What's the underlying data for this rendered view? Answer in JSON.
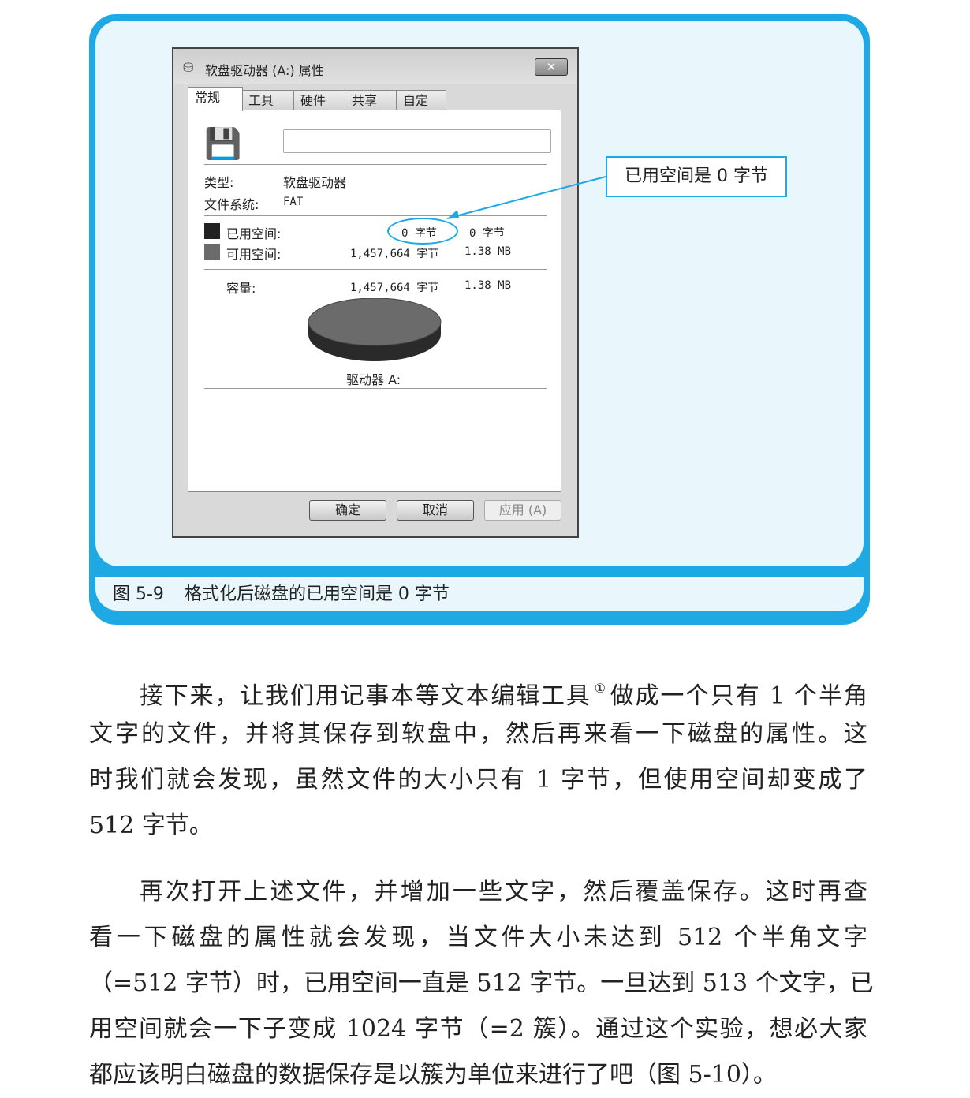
{
  "dialog": {
    "title": "软盘驱动器 (A:) 属性",
    "close": "✕",
    "tabs": [
      "常规",
      "工具",
      "硬件",
      "共享",
      "自定义"
    ],
    "name_value": "",
    "type_label": "类型:",
    "type_value": "软盘驱动器",
    "fs_label": "文件系统:",
    "fs_value": "FAT",
    "used_label": "已用空间:",
    "used_bytes": "0 字节",
    "used_size": "0 字节",
    "free_label": "可用空间:",
    "free_bytes": "1,457,664 字节",
    "free_size": "1.38 MB",
    "cap_label": "容量:",
    "cap_bytes": "1,457,664 字节",
    "cap_size": "1.38 MB",
    "drive_label": "驱动器 A:",
    "ok": "确定",
    "cancel": "取消",
    "apply": "应用 (A)",
    "colors": {
      "used": "#222222",
      "free": "#6b6b6b"
    }
  },
  "callout": "已用空间是 0 字节",
  "caption": {
    "number": "图 5-9",
    "text": "格式化后磁盘的已用空间是 0 字节"
  },
  "body": {
    "p1_line1_a": "接下来，让我们用记事本等文本编辑工具",
    "p1_footnote": "①",
    "p1_line1_b": "做成一个只有 1 个半角",
    "p1_lines": [
      "文字的文件，并将其保存到软盘中，然后再来看一下磁盘的属性。这",
      "时我们就会发现，虽然文件的大小只有 1 字节，但使用空间却变成了",
      "512 字节。"
    ],
    "p2_lines": [
      "再次打开上述文件，并增加一些文字，然后覆盖保存。这时再查",
      "看一下磁盘的属性就会发现，当文件大小未达到 512 个半角文字",
      "（=512 字节）时，已用空间一直是 512 字节。一旦达到 513 个文字，已",
      "用空间就会一下子变成 1024 字节（=2 簇）。通过这个实验，想必大家",
      "都应该明白磁盘的数据保存是以簇为单位来进行了吧（图 5-10）。"
    ]
  }
}
